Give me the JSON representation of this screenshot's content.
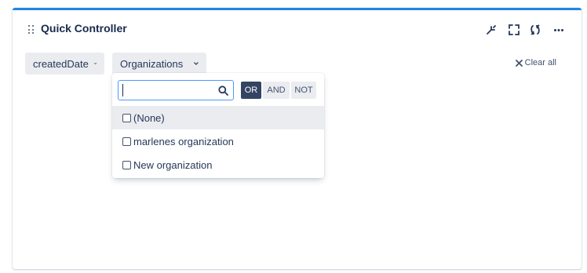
{
  "widget": {
    "title": "Quick Controller",
    "accent_color": "#1f87e5",
    "header_icons": [
      "drag-handle-icon",
      "minimize-icon",
      "fullscreen-icon",
      "refresh-icon",
      "more-icon"
    ]
  },
  "filters": [
    {
      "label": "createdDate",
      "icon": "chevron-down-icon"
    },
    {
      "label": "Organizations",
      "icon": "chevron-down-icon",
      "open": true
    }
  ],
  "clear_all": {
    "label": "Clear all",
    "icon": "close-icon"
  },
  "dropdown": {
    "search": {
      "value": "",
      "placeholder": "",
      "icon": "search-icon"
    },
    "operators": [
      {
        "label": "OR",
        "active": true
      },
      {
        "label": "AND",
        "active": false
      },
      {
        "label": "NOT",
        "active": false
      }
    ],
    "options": [
      {
        "label": "(None)",
        "checked": false,
        "hovered": true
      },
      {
        "label": "marlenes organization",
        "checked": false
      },
      {
        "label": "New organization",
        "checked": false
      }
    ]
  }
}
